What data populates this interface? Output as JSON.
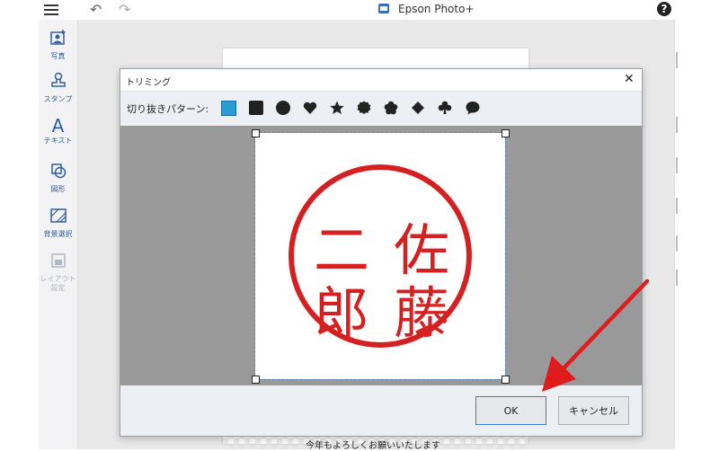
{
  "app": {
    "title": "Epson Photo+"
  },
  "topbar": {
    "help_icon": "help-icon",
    "help_extra": "ʕ"
  },
  "sidebar": {
    "items": [
      {
        "label": "写真",
        "icon": "photo-icon"
      },
      {
        "label": "スタンプ",
        "icon": "stamp-icon"
      },
      {
        "label": "テキスト",
        "icon": "text-icon"
      },
      {
        "label": "図形",
        "icon": "shape-icon"
      },
      {
        "label": "背景選択",
        "icon": "background-icon"
      },
      {
        "label": "レイアウト\n設定",
        "icon": "layout-icon"
      }
    ]
  },
  "workspace": {
    "bottom_text": "今年もよろしくお願いいたします"
  },
  "dialog": {
    "title": "トリミング",
    "pattern_label": "切り抜きパターン:",
    "patterns": [
      "square-light",
      "square",
      "circle",
      "heart",
      "star",
      "badge",
      "flower",
      "diamond",
      "clover",
      "speech-bubble"
    ],
    "seal_chars": [
      "佐",
      "藤",
      "二",
      "郎"
    ],
    "seal_color": "#d42020",
    "ok_label": "OK",
    "cancel_label": "キャンセル"
  }
}
